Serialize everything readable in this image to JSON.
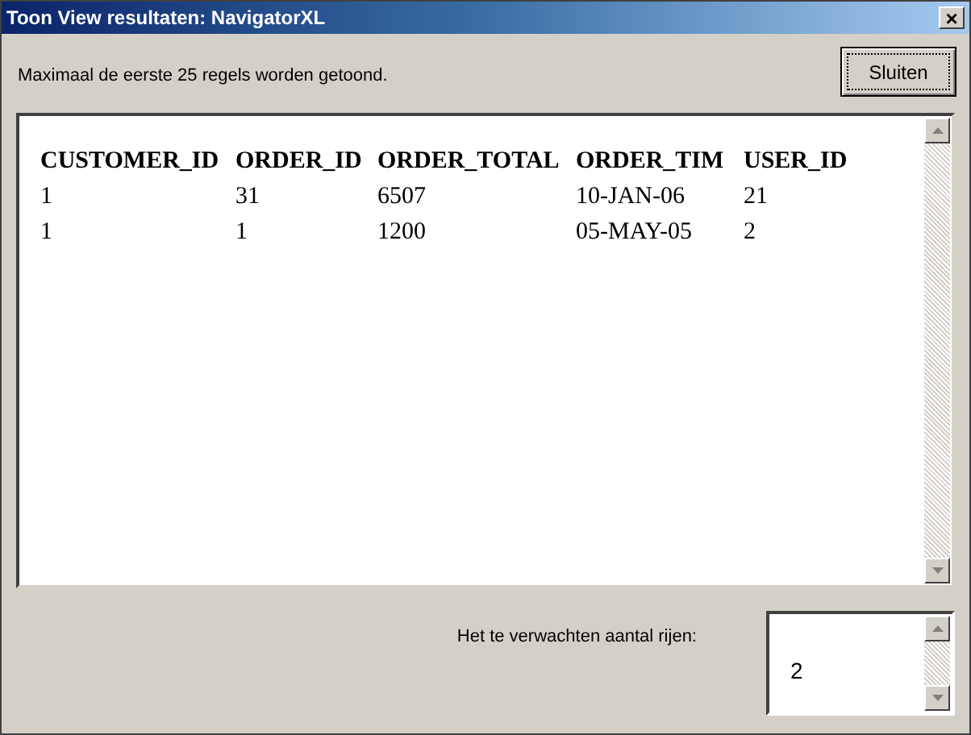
{
  "window": {
    "title": "Toon View resultaten: NavigatorXL",
    "close_label": "×"
  },
  "message": "Maximaal de eerste 25 regels worden getoond.",
  "close_button": "Sluiten",
  "table": {
    "columns": [
      "CUSTOMER_ID",
      "ORDER_ID",
      "ORDER_TOTAL",
      "ORDER_TIM",
      "USER_ID"
    ],
    "rows": [
      [
        "1",
        "31",
        "6507",
        "10-JAN-06",
        "21"
      ],
      [
        "1",
        "1",
        "1200",
        "05-MAY-05",
        "2"
      ]
    ]
  },
  "row_count": {
    "label": "Het te verwachten aantal rijen:",
    "value": "2"
  }
}
